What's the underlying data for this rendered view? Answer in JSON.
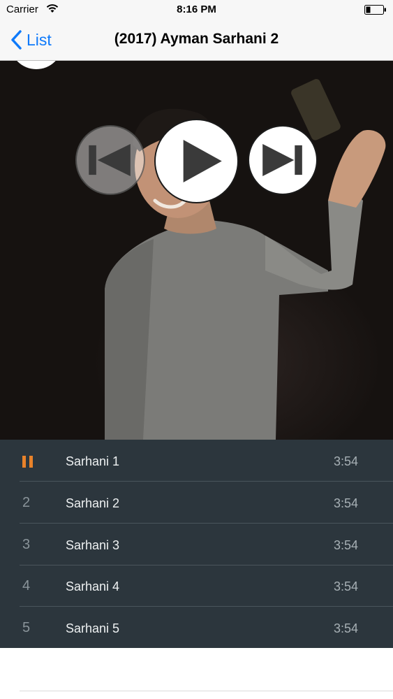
{
  "status_bar": {
    "carrier": "Carrier",
    "time": "8:16 PM",
    "wifi_icon": "wifi-icon",
    "battery_icon": "battery-icon"
  },
  "nav": {
    "back_label": "List",
    "back_icon": "chevron-left-icon",
    "title": "(2017) Ayman Sarhani 2",
    "accent_color": "#0f7afa"
  },
  "player": {
    "prev_icon": "skip-previous-icon",
    "play_icon": "play-icon",
    "next_icon": "skip-next-icon"
  },
  "tracks": [
    {
      "number": "",
      "status": "playing",
      "status_icon": "pause-icon",
      "title": "Sarhani 1",
      "duration": "3:54"
    },
    {
      "number": "2",
      "title": "Sarhani 2",
      "duration": "3:54"
    },
    {
      "number": "3",
      "title": "Sarhani 3",
      "duration": "3:54"
    },
    {
      "number": "4",
      "title": "Sarhani 4",
      "duration": "3:54"
    },
    {
      "number": "5",
      "title": "Sarhani 5",
      "duration": "3:54"
    }
  ],
  "colors": {
    "list_background": "#2c363d",
    "playing_indicator": "#e8822a"
  }
}
